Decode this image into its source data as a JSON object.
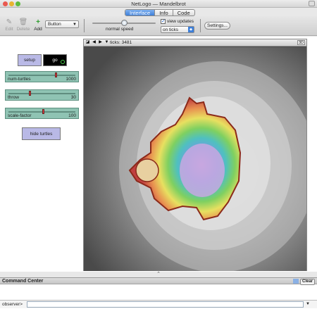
{
  "window": {
    "title": "NetLogo — Mandelbrot"
  },
  "tabs": [
    {
      "label": "Interface"
    },
    {
      "label": "Info"
    },
    {
      "label": "Code"
    }
  ],
  "toolbar": {
    "edit_label": "Edit",
    "delete_label": "Delete",
    "add_label": "Add",
    "widget_select": "Button",
    "speed_label": "normal speed",
    "view_updates_label": "view updates",
    "view_updates_checked": true,
    "update_mode": "on ticks",
    "settings_label": "Settings..."
  },
  "buttons": {
    "setup": "setup",
    "go": "go",
    "hide_turtles": "hide turtles"
  },
  "sliders": [
    {
      "name": "num-turtles",
      "value": "1000",
      "fraction": 0.72
    },
    {
      "name": "throw",
      "value": "30",
      "fraction": 0.3
    },
    {
      "name": "scale-factor",
      "value": "100",
      "fraction": 0.52
    }
  ],
  "view": {
    "ticks_label": "ticks: 3481",
    "three_d_label": "3D"
  },
  "command_center": {
    "title": "Command Center",
    "clear_label": "Clear",
    "prompt": "observer>"
  },
  "colors": {
    "accent": "#3d7fd9",
    "button_bg": "#b9b9e6",
    "slider_bg": "#8fc3b3"
  }
}
